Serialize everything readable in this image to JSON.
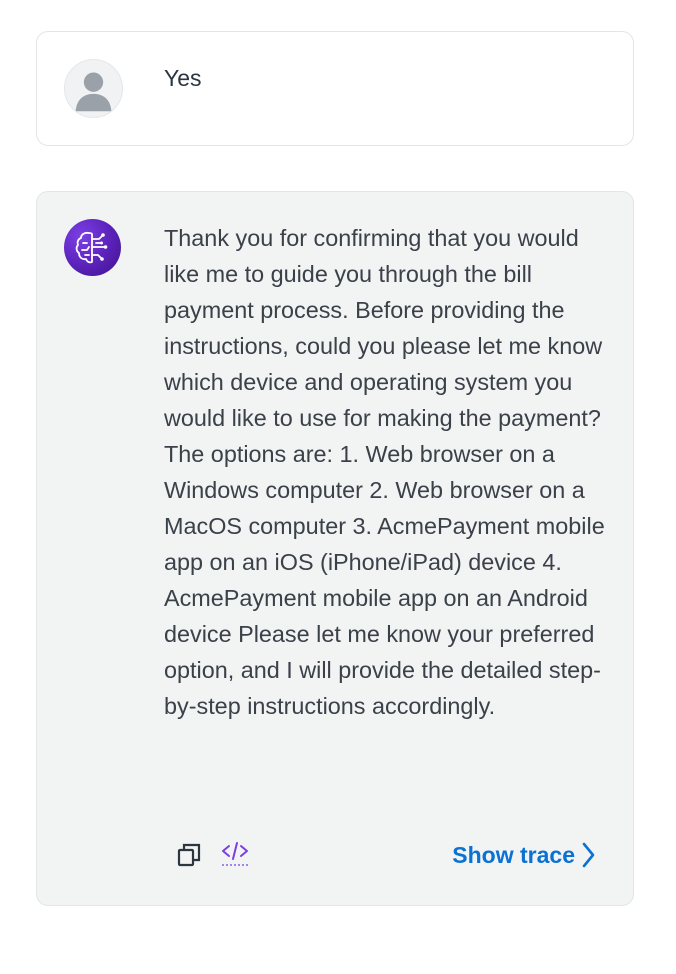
{
  "user_message": {
    "text": "Yes",
    "avatar_icon": "user-avatar-icon"
  },
  "assistant_message": {
    "avatar_icon": "ai-brain-icon",
    "text": "Thank you for confirming that you would like me to guide you through the bill payment process. Before providing the instructions, could you please let me know which device and operating system you would like to use for making the payment? The options are: 1. Web browser on a Windows computer 2. Web browser on a MacOS computer 3. AcmePayment mobile app on an iOS (iPhone/iPad) device 4. AcmePayment mobile app on an Android device Please let me know your preferred option, and I will provide the detailed step-by-step instructions accordingly."
  },
  "actions": {
    "copy_icon": "copy-icon",
    "code_icon": "code-icon",
    "show_trace_label": "Show trace",
    "chevron_icon": "chevron-right-icon"
  },
  "colors": {
    "link": "#0972d3",
    "accent_purple": "#6b2fd3",
    "bot_bg": "#f2f3f3",
    "border": "#e3e5e8"
  }
}
